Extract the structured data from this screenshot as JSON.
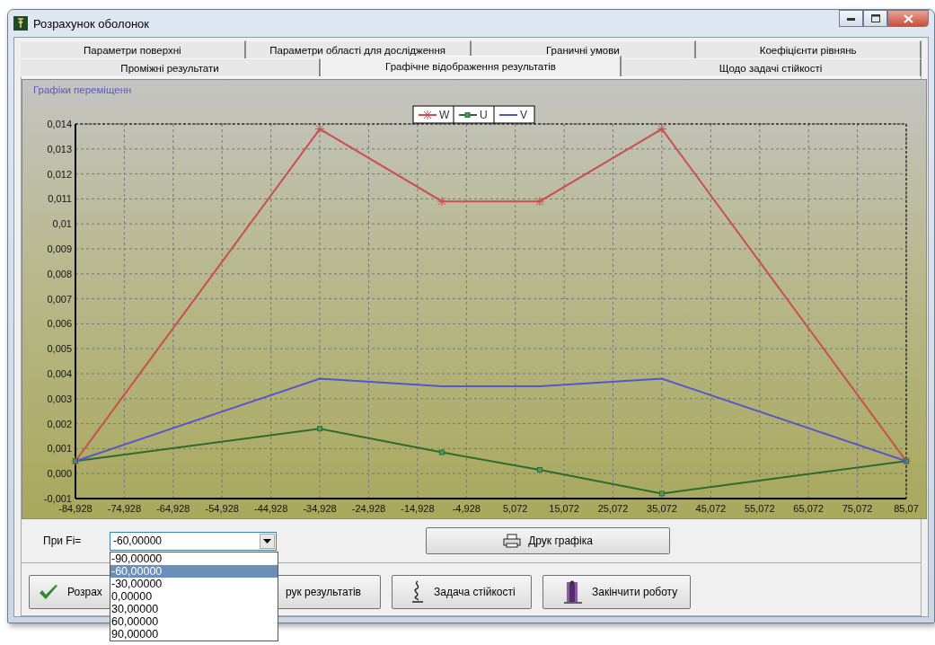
{
  "window": {
    "title": "Розрахунок оболонок"
  },
  "tab_rows": [
    {
      "tabs": [
        {
          "label": "Параметри поверхні",
          "selected": false
        },
        {
          "label": "Параметри області для дослідження",
          "selected": false
        },
        {
          "label": "Граничні умови",
          "selected": false
        },
        {
          "label": "Коефіцієнти рівнянь",
          "selected": false
        }
      ]
    },
    {
      "tabs": [
        {
          "label": "Проміжні результати",
          "selected": false
        },
        {
          "label": "Графічне відображення результатів",
          "selected": true
        },
        {
          "label": "Щодо задачі стійкості",
          "selected": false
        }
      ]
    }
  ],
  "chart": {
    "title": "Графіки переміщенн",
    "chart_data": {
      "type": "line",
      "x": [
        -84.928,
        -34.928,
        -9.928,
        10.072,
        35.072,
        85.072
      ],
      "series": [
        {
          "name": "W",
          "color": "#c85050",
          "marker": "cross",
          "values": [
            0.0005,
            0.0138,
            0.0109,
            0.0109,
            0.0138,
            0.0005
          ]
        },
        {
          "name": "U",
          "color": "#2f6b2f",
          "marker": "square",
          "values": [
            0.0005,
            0.0018,
            0.00085,
            0.00015,
            -0.0008,
            0.0005
          ]
        },
        {
          "name": "V",
          "color": "#5555cc",
          "values": [
            0.0005,
            0.0038,
            0.0035,
            0.0035,
            0.0038,
            0.0005
          ]
        }
      ],
      "grid": true,
      "legend": "top",
      "xlim": [
        -84.928,
        85.072
      ],
      "ylim": [
        -0.001,
        0.014
      ],
      "xticks": [
        {
          "value": -84.928,
          "label": "-84,928"
        },
        {
          "value": -74.928,
          "label": "-74,928"
        },
        {
          "value": -64.928,
          "label": "-64,928"
        },
        {
          "value": -54.928,
          "label": "-54,928"
        },
        {
          "value": -44.928,
          "label": "-44,928"
        },
        {
          "value": -34.928,
          "label": "-34,928"
        },
        {
          "value": -24.928,
          "label": "-24,928"
        },
        {
          "value": -14.928,
          "label": "-14,928"
        },
        {
          "value": -4.928,
          "label": "-4,928"
        },
        {
          "value": 5.072,
          "label": "5,072"
        },
        {
          "value": 15.072,
          "label": "15,072"
        },
        {
          "value": 25.072,
          "label": "25,072"
        },
        {
          "value": 35.072,
          "label": "35,072"
        },
        {
          "value": 45.072,
          "label": "45,072"
        },
        {
          "value": 55.072,
          "label": "55,072"
        },
        {
          "value": 65.072,
          "label": "65,072"
        },
        {
          "value": 75.072,
          "label": "75,072"
        },
        {
          "value": 85.072,
          "label": "85,07"
        }
      ],
      "yticks": [
        {
          "value": -0.001,
          "label": "-0,001"
        },
        {
          "value": 0,
          "label": "0,000"
        },
        {
          "value": 0.001,
          "label": "0,001"
        },
        {
          "value": 0.002,
          "label": "0,002"
        },
        {
          "value": 0.003,
          "label": "0,003"
        },
        {
          "value": 0.004,
          "label": "0,004"
        },
        {
          "value": 0.005,
          "label": "0,005"
        },
        {
          "value": 0.006,
          "label": "0,006"
        },
        {
          "value": 0.007,
          "label": "0,007"
        },
        {
          "value": 0.008,
          "label": "0,008"
        },
        {
          "value": 0.009,
          "label": "0,009"
        },
        {
          "value": 0.01,
          "label": "0,01"
        },
        {
          "value": 0.011,
          "label": "0,011"
        },
        {
          "value": 0.012,
          "label": "0,012"
        },
        {
          "value": 0.013,
          "label": "0,013"
        },
        {
          "value": 0.014,
          "label": "0,014"
        }
      ]
    }
  },
  "angle": {
    "label": "При Fi=",
    "value": "-60,00000",
    "expanded": true,
    "options": [
      {
        "label": "-90,00000",
        "selected": false
      },
      {
        "label": "-60,00000",
        "selected": true
      },
      {
        "label": "-30,00000",
        "selected": false
      },
      {
        "label": "0,00000",
        "selected": false
      },
      {
        "label": "30,00000",
        "selected": false
      },
      {
        "label": "60,00000",
        "selected": false
      },
      {
        "label": "90,00000",
        "selected": false
      }
    ]
  },
  "print_chart_button": {
    "label": "Друк графіка"
  },
  "buttons": [
    {
      "label": "Розрах",
      "kind": "check"
    },
    {
      "label": "рук результатів",
      "kind": "none"
    },
    {
      "label": "Задача стійкості",
      "kind": "spring"
    },
    {
      "label": "Закінчити роботу",
      "kind": "exit"
    }
  ]
}
